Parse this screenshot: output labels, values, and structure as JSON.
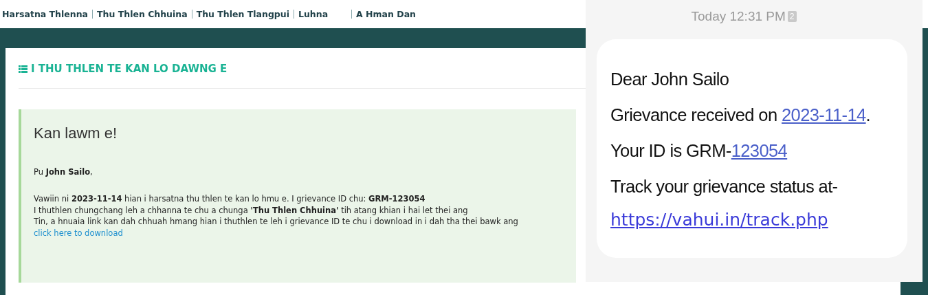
{
  "nav": [
    {
      "label": "Harsatna Thlenna"
    },
    {
      "label": "Thu Thlen Chhuina"
    },
    {
      "label": "Thu Thlen Tlangpui"
    },
    {
      "label": "Luhna"
    },
    {
      "label": "A Hman Dan"
    }
  ],
  "panel": {
    "title": "I THU THLEN TE KAN LO DAWNG E",
    "alert": {
      "heading": "Kan lawm e!",
      "greeting": "Pu **John Sailo**,",
      "lines": [
        "Vawiin ni **2023-11-14** hian i harsatna thu thlen te kan lo hmu e. I grievance ID chu: **GRM-123054**",
        "I thuthlen chungchang leh a chhanna te chu a chunga **'Thu Thlen Chhuina'** tih atang khian i hai let thei ang",
        "Tin, a hnuaia link kan dah chhuah hmang hian i thuthlen te leh i grievance ID te chu i download in i dah tha thei bawk ang"
      ],
      "link": "click here to download"
    }
  },
  "sms": {
    "time": "Today 12:31 PM",
    "sim": "2",
    "lines": [
      [
        {
          "kind": "text",
          "text": "Dear John Sailo"
        }
      ],
      [
        {
          "kind": "text",
          "text": "Grievance received on "
        },
        {
          "kind": "link",
          "text": "2023-11-14"
        },
        {
          "kind": "text",
          "text": "."
        }
      ],
      [
        {
          "kind": "text",
          "text": "Your ID is GRM-"
        },
        {
          "kind": "link",
          "text": "123054"
        }
      ],
      [
        {
          "kind": "text",
          "text": "Track your grievance status at-"
        }
      ],
      [
        {
          "kind": "url",
          "text": "https://vahui.in/track.php"
        }
      ]
    ]
  }
}
